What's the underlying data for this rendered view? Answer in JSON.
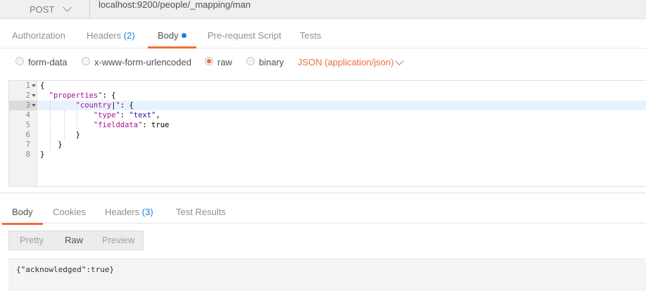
{
  "request": {
    "method": "POST",
    "url": "localhost:9200/people/_mapping/man"
  },
  "request_tabs": [
    {
      "label": "Authorization",
      "count": ""
    },
    {
      "label": "Headers",
      "count": "(2)"
    },
    {
      "label": "Body",
      "count": ""
    },
    {
      "label": "Pre-request Script",
      "count": ""
    },
    {
      "label": "Tests",
      "count": ""
    }
  ],
  "body_modes": {
    "form_data": "form-data",
    "urlencoded": "x-www-form-urlencoded",
    "raw": "raw",
    "binary": "binary",
    "content_type": "JSON (application/json)"
  },
  "editor": {
    "line_numbers": [
      "1",
      "2",
      "3",
      "4",
      "5",
      "6",
      "7",
      "8"
    ],
    "active_line": "3"
  },
  "response_tabs": [
    {
      "label": "Body",
      "count": ""
    },
    {
      "label": "Cookies",
      "count": ""
    },
    {
      "label": "Headers",
      "count": "(3)"
    },
    {
      "label": "Test Results",
      "count": ""
    }
  ],
  "view_modes": {
    "pretty": "Pretty",
    "raw": "Raw",
    "preview": "Preview"
  },
  "response": {
    "body": "{\"acknowledged\":true}"
  },
  "colors": {
    "accent": "#f26b3a",
    "link": "#1e7fd6",
    "json_key": "#a31590",
    "json_string": "#1a1aa6"
  }
}
